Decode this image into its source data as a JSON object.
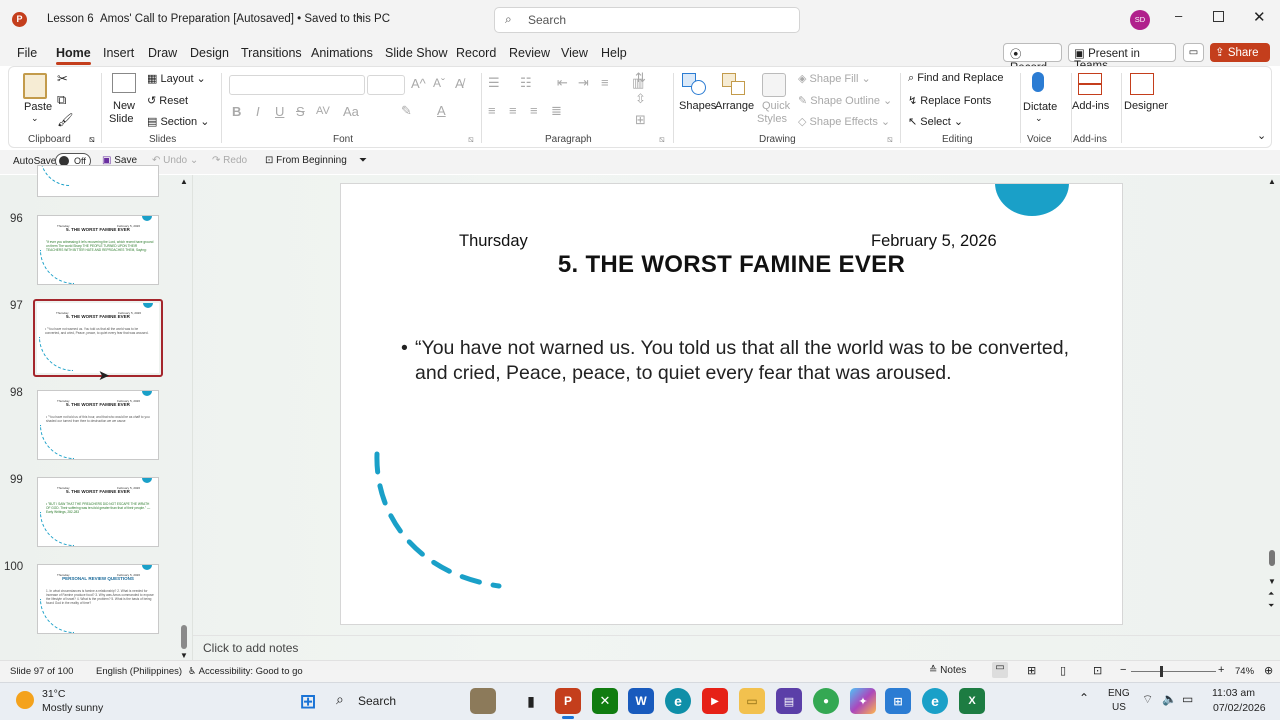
{
  "titlebar": {
    "doc_name": "Lesson 6",
    "file_title": "Amos' Call to Preparation [Autosaved] • Saved to this PC",
    "search_placeholder": "Search",
    "avatar": "SD"
  },
  "menu": {
    "tabs": [
      "File",
      "Home",
      "Insert",
      "Draw",
      "Design",
      "Transitions",
      "Animations",
      "Slide Show",
      "Record",
      "Review",
      "View",
      "Help"
    ],
    "active": "Home",
    "record_btn": "Record",
    "teams_btn": "Present in Teams",
    "share_btn": "Share"
  },
  "ribbon": {
    "clipboard": {
      "paste": "Paste",
      "label": "Clipboard"
    },
    "slides": {
      "new_slide_1": "New",
      "new_slide_2": "Slide",
      "layout": "Layout",
      "reset": "Reset",
      "section": "Section",
      "label": "Slides"
    },
    "font": {
      "label": "Font",
      "bold": "B",
      "italic": "I",
      "underline": "U",
      "strike": "S",
      "spacing": "AV",
      "case": "Aa"
    },
    "paragraph": {
      "label": "Paragraph"
    },
    "drawing": {
      "shapes": "Shapes",
      "arrange": "Arrange",
      "quick_styles_1": "Quick",
      "quick_styles_2": "Styles",
      "shape_fill": "Shape Fill",
      "shape_outline": "Shape Outline",
      "shape_effects": "Shape Effects",
      "label": "Drawing"
    },
    "editing": {
      "find_replace": "Find and Replace",
      "replace_fonts": "Replace Fonts",
      "select": "Select",
      "label": "Editing"
    },
    "voice": {
      "dictate": "Dictate",
      "label": "Voice"
    },
    "addins": {
      "addins": "Add-ins",
      "label": "Add-ins"
    },
    "designer": {
      "label": "Designer"
    }
  },
  "qat": {
    "autosave": "AutoSave",
    "toggle": "Off",
    "save": "Save",
    "undo": "Undo",
    "redo": "Redo",
    "from_beginning": "From Beginning"
  },
  "thumbnails": [
    {
      "num": "96",
      "title": "5. THE WORST FAMINE EVER",
      "body": "\"If ever you witnessing it let's recovering the Lord, which recent have ground on them The world Sharp THE PEOPLE TURNED UPON THEIR TEACHERS WITH BITTER HATE AND REPROACHES THEM, Saying:"
    },
    {
      "num": "97",
      "title": "5. THE WORST FAMINE EVER",
      "body": "• \"You have not warned us. You told us that all the world was to be converted, and cried, Peace, peace, to quiet every fear that was aroused."
    },
    {
      "num": "98",
      "title": "5. THE WORST FAMINE EVER",
      "body": "• \"You have not told us of this hour, and that who would be as chaff to you shaded our turned from thee to destruction we we cause"
    },
    {
      "num": "99",
      "title": "5. THE WORST FAMINE EVER",
      "body": "• \"BUT I SAW THAT THE PREACHERS DID NOT ESCAPE THE WRATH OF GOD. Their suffering was ten-fold greater than that of their people.\" — Early Writings, 282-283"
    },
    {
      "num": "100",
      "title": "PERSONAL REVIEW QUESTIONS",
      "body": "1. In what circumstances is famine a relationship? 2. What is needed for increase of Famine produce food? 3. Why was Amos commanded to expose the lifestyle of Israel? 4. What is the problem? 5. What is the basis of being found God in the reality of time?"
    }
  ],
  "slide": {
    "day": "Thursday",
    "date": "February 5, 2026",
    "title": "5. THE WORST FAMINE EVER",
    "bullet": "“You have not warned us. You told us that all the world was to be converted, and cried, Peace, peace, to quiet every fear that was aroused.",
    "bullet_marker": "•"
  },
  "notes_placeholder": "Click to add notes",
  "status": {
    "slide_count": "Slide 97 of 100",
    "language": "English (Philippines)",
    "accessibility": "Accessibility: Good to go",
    "notes": "Notes",
    "zoom": "74%"
  },
  "taskbar": {
    "temp": "31°C",
    "weather": "Mostly sunny",
    "search": "Search",
    "lang1": "ENG",
    "lang2": "US",
    "time": "11:03 am",
    "date": "07/02/2026"
  },
  "colors": {
    "accent": "#c43e1c",
    "teal": "#1aa0c8",
    "selected_thumb": "#a4262c"
  }
}
